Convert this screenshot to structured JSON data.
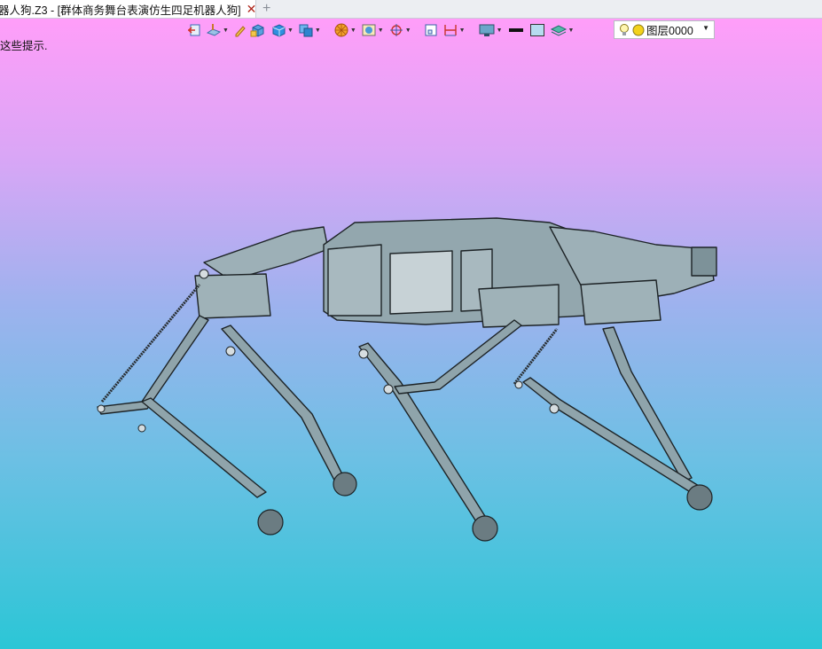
{
  "tab": {
    "title": "器人狗.Z3 - [群体商务舞台表演仿生四足机器人狗]",
    "close_icon": "close-icon",
    "add_icon": "plus-icon"
  },
  "viewport": {
    "hint_text": "这些提示."
  },
  "toolbar": {
    "layer_select": {
      "value": "图层0000"
    }
  },
  "colors": {
    "background_top": "#ff9ef9",
    "background_bottom": "#2bc6d6",
    "model_fill": "#8fa4ab",
    "model_stroke": "#1d2326"
  }
}
